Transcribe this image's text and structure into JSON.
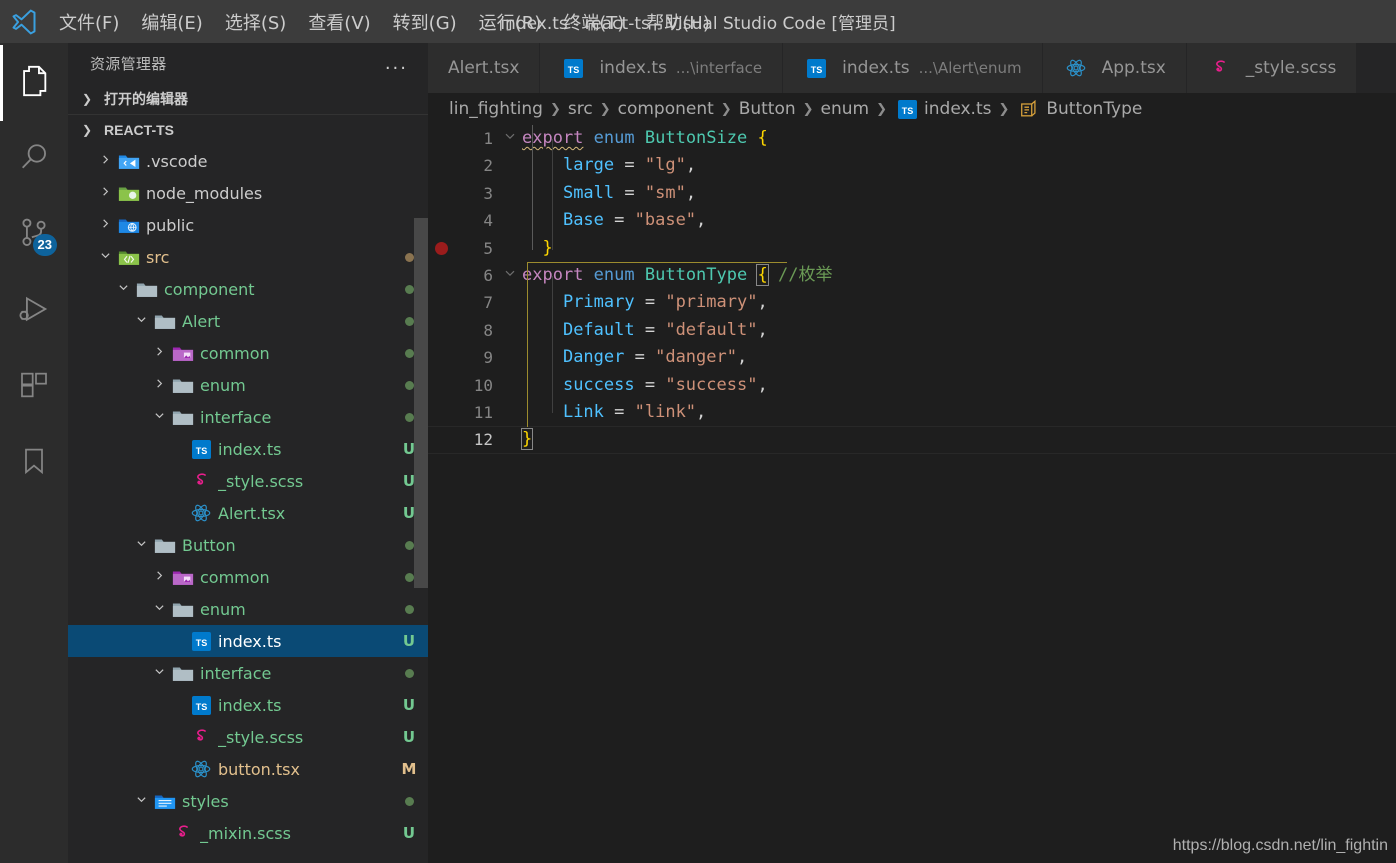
{
  "titlebar": {
    "window_title": "index.ts - react-ts - Visual Studio Code [管理员]",
    "logo_icon": "vscode-logo-icon",
    "menu": [
      {
        "label": "文件(F)"
      },
      {
        "label": "编辑(E)"
      },
      {
        "label": "选择(S)"
      },
      {
        "label": "查看(V)"
      },
      {
        "label": "转到(G)"
      },
      {
        "label": "运行(R)"
      },
      {
        "label": "终端(T)"
      },
      {
        "label": "帮助(H)"
      }
    ]
  },
  "activitybar": {
    "items": [
      {
        "icon": "files-explorer-icon",
        "name": "explorer",
        "active": true,
        "badge": ""
      },
      {
        "icon": "search-icon",
        "name": "search",
        "active": false,
        "badge": ""
      },
      {
        "icon": "source-control-icon",
        "name": "source-control",
        "active": false,
        "badge": "23"
      },
      {
        "icon": "run-debug-icon",
        "name": "run-and-debug",
        "active": false,
        "badge": ""
      },
      {
        "icon": "extensions-icon",
        "name": "extensions",
        "active": false,
        "badge": ""
      },
      {
        "icon": "bookmark-icon",
        "name": "bookmarks",
        "active": false,
        "badge": ""
      }
    ]
  },
  "sidebar": {
    "title": "资源管理器",
    "more_actions": "...",
    "sections": [
      {
        "label": "打开的编辑器",
        "expanded": false
      },
      {
        "label": "REACT-TS",
        "expanded": true
      }
    ],
    "tree": [
      {
        "indent": 1,
        "twisty": "collapsed",
        "icon": "vscode-folder-icon",
        "label": ".vscode",
        "badge": "",
        "color": "plain",
        "selected": false
      },
      {
        "indent": 1,
        "twisty": "collapsed",
        "icon": "node-folder-icon",
        "label": "node_modules",
        "badge": "",
        "color": "plain",
        "selected": false
      },
      {
        "indent": 1,
        "twisty": "collapsed",
        "icon": "public-folder-icon",
        "label": "public",
        "badge": "",
        "color": "plain",
        "selected": false
      },
      {
        "indent": 1,
        "twisty": "expanded",
        "icon": "src-folder-icon",
        "label": "src",
        "badge": "dot",
        "color": "orange",
        "selected": false
      },
      {
        "indent": 2,
        "twisty": "expanded",
        "icon": "folder-icon",
        "label": "component",
        "badge": "dot",
        "color": "green",
        "selected": false
      },
      {
        "indent": 3,
        "twisty": "expanded",
        "icon": "folder-icon",
        "label": "Alert",
        "badge": "dot",
        "color": "green",
        "selected": false
      },
      {
        "indent": 4,
        "twisty": "collapsed",
        "icon": "common-folder-icon",
        "label": "common",
        "badge": "dot",
        "color": "green",
        "selected": false
      },
      {
        "indent": 4,
        "twisty": "collapsed",
        "icon": "folder-icon",
        "label": "enum",
        "badge": "dot",
        "color": "green",
        "selected": false
      },
      {
        "indent": 4,
        "twisty": "expanded",
        "icon": "folder-icon",
        "label": "interface",
        "badge": "dot",
        "color": "green",
        "selected": false
      },
      {
        "indent": 5,
        "twisty": "none",
        "icon": "typescript-icon",
        "label": "index.ts",
        "badge": "U",
        "color": "green",
        "selected": false
      },
      {
        "indent": 5,
        "twisty": "none",
        "icon": "sass-icon",
        "label": "_style.scss",
        "badge": "U",
        "color": "green",
        "selected": false
      },
      {
        "indent": 5,
        "twisty": "none",
        "icon": "react-icon",
        "label": "Alert.tsx",
        "badge": "U",
        "color": "green",
        "selected": false
      },
      {
        "indent": 3,
        "twisty": "expanded",
        "icon": "folder-icon",
        "label": "Button",
        "badge": "dot",
        "color": "green",
        "selected": false
      },
      {
        "indent": 4,
        "twisty": "collapsed",
        "icon": "common-folder-icon",
        "label": "common",
        "badge": "dot",
        "color": "green",
        "selected": false
      },
      {
        "indent": 4,
        "twisty": "expanded",
        "icon": "folder-icon",
        "label": "enum",
        "badge": "dot",
        "color": "green",
        "selected": false
      },
      {
        "indent": 5,
        "twisty": "none",
        "icon": "typescript-icon",
        "label": "index.ts",
        "badge": "U",
        "color": "green",
        "selected": true
      },
      {
        "indent": 4,
        "twisty": "expanded",
        "icon": "folder-icon",
        "label": "interface",
        "badge": "dot",
        "color": "green",
        "selected": false
      },
      {
        "indent": 5,
        "twisty": "none",
        "icon": "typescript-icon",
        "label": "index.ts",
        "badge": "U",
        "color": "green",
        "selected": false
      },
      {
        "indent": 5,
        "twisty": "none",
        "icon": "sass-icon",
        "label": "_style.scss",
        "badge": "U",
        "color": "green",
        "selected": false
      },
      {
        "indent": 5,
        "twisty": "none",
        "icon": "react-icon",
        "label": "button.tsx",
        "badge": "M",
        "color": "orange",
        "selected": false
      },
      {
        "indent": 3,
        "twisty": "expanded",
        "icon": "styles-folder-icon",
        "label": "styles",
        "badge": "dot",
        "color": "green",
        "selected": false
      },
      {
        "indent": 4,
        "twisty": "none",
        "icon": "sass-icon",
        "label": "_mixin.scss",
        "badge": "U",
        "color": "green",
        "selected": false
      }
    ]
  },
  "tabs": [
    {
      "label": "Alert.tsx",
      "desc": "",
      "icon": "none",
      "active": false
    },
    {
      "label": "index.ts",
      "desc": "...\\interface",
      "icon": "typescript-icon",
      "active": false
    },
    {
      "label": "index.ts",
      "desc": "...\\Alert\\enum",
      "icon": "typescript-icon",
      "active": false
    },
    {
      "label": "App.tsx",
      "desc": "",
      "icon": "react-icon",
      "active": false
    },
    {
      "label": "_style.scss",
      "desc": "",
      "icon": "sass-icon",
      "active": false
    }
  ],
  "breadcrumb": [
    {
      "label": "lin_fighting",
      "icon": "none"
    },
    {
      "label": "src",
      "icon": "none"
    },
    {
      "label": "component",
      "icon": "none"
    },
    {
      "label": "Button",
      "icon": "none"
    },
    {
      "label": "enum",
      "icon": "none"
    },
    {
      "label": "index.ts",
      "icon": "typescript-icon"
    },
    {
      "label": "ButtonType",
      "icon": "enum-symbol-icon"
    }
  ],
  "editor": {
    "breakpoint_line": 5,
    "current_line": 12,
    "lines": [
      {
        "n": "1",
        "fold": "expanded",
        "tokens": [
          {
            "t": "export",
            "c": "kw squig"
          },
          {
            "t": " ",
            "c": "op"
          },
          {
            "t": "enum",
            "c": "kw2"
          },
          {
            "t": " ",
            "c": "op"
          },
          {
            "t": "ButtonSize",
            "c": "type"
          },
          {
            "t": " ",
            "c": "op"
          },
          {
            "t": "{",
            "c": "brace"
          }
        ]
      },
      {
        "n": "2",
        "fold": "",
        "tokens": [
          {
            "t": "    ",
            "c": "op"
          },
          {
            "t": "large",
            "c": "prop"
          },
          {
            "t": " = ",
            "c": "op"
          },
          {
            "t": "\"lg\"",
            "c": "str"
          },
          {
            "t": ",",
            "c": "op"
          }
        ]
      },
      {
        "n": "3",
        "fold": "",
        "tokens": [
          {
            "t": "    ",
            "c": "op"
          },
          {
            "t": "Small",
            "c": "prop"
          },
          {
            "t": " = ",
            "c": "op"
          },
          {
            "t": "\"sm\"",
            "c": "str"
          },
          {
            "t": ",",
            "c": "op"
          }
        ]
      },
      {
        "n": "4",
        "fold": "",
        "tokens": [
          {
            "t": "    ",
            "c": "op"
          },
          {
            "t": "Base",
            "c": "prop"
          },
          {
            "t": " = ",
            "c": "op"
          },
          {
            "t": "\"base\"",
            "c": "str"
          },
          {
            "t": ",",
            "c": "op"
          }
        ]
      },
      {
        "n": "5",
        "fold": "",
        "tokens": [
          {
            "t": "  ",
            "c": "op"
          },
          {
            "t": "}",
            "c": "brace"
          }
        ]
      },
      {
        "n": "6",
        "fold": "expanded",
        "tokens": [
          {
            "t": "export",
            "c": "kw"
          },
          {
            "t": " ",
            "c": "op"
          },
          {
            "t": "enum",
            "c": "kw2"
          },
          {
            "t": " ",
            "c": "op"
          },
          {
            "t": "ButtonType",
            "c": "type"
          },
          {
            "t": " ",
            "c": "op"
          },
          {
            "t": "{",
            "c": "brace bmatch"
          },
          {
            "t": " ",
            "c": "op"
          },
          {
            "t": "//枚举",
            "c": "cmt"
          }
        ]
      },
      {
        "n": "7",
        "fold": "",
        "tokens": [
          {
            "t": "    ",
            "c": "op"
          },
          {
            "t": "Primary",
            "c": "prop"
          },
          {
            "t": " = ",
            "c": "op"
          },
          {
            "t": "\"primary\"",
            "c": "str"
          },
          {
            "t": ",",
            "c": "op"
          }
        ]
      },
      {
        "n": "8",
        "fold": "",
        "tokens": [
          {
            "t": "    ",
            "c": "op"
          },
          {
            "t": "Default",
            "c": "prop"
          },
          {
            "t": " = ",
            "c": "op"
          },
          {
            "t": "\"default\"",
            "c": "str"
          },
          {
            "t": ",",
            "c": "op"
          }
        ]
      },
      {
        "n": "9",
        "fold": "",
        "tokens": [
          {
            "t": "    ",
            "c": "op"
          },
          {
            "t": "Danger",
            "c": "prop"
          },
          {
            "t": " = ",
            "c": "op"
          },
          {
            "t": "\"danger\"",
            "c": "str"
          },
          {
            "t": ",",
            "c": "op"
          }
        ]
      },
      {
        "n": "10",
        "fold": "",
        "tokens": [
          {
            "t": "    ",
            "c": "op"
          },
          {
            "t": "success",
            "c": "prop"
          },
          {
            "t": " = ",
            "c": "op"
          },
          {
            "t": "\"success\"",
            "c": "str"
          },
          {
            "t": ",",
            "c": "op"
          }
        ]
      },
      {
        "n": "11",
        "fold": "",
        "tokens": [
          {
            "t": "    ",
            "c": "op"
          },
          {
            "t": "Link",
            "c": "prop"
          },
          {
            "t": " = ",
            "c": "op"
          },
          {
            "t": "\"link\"",
            "c": "str"
          },
          {
            "t": ",",
            "c": "op"
          }
        ]
      },
      {
        "n": "12",
        "fold": "",
        "tokens": [
          {
            "t": "}",
            "c": "brace bmatch"
          }
        ]
      }
    ]
  },
  "watermark": "https://blog.csdn.net/lin_fightin",
  "colors": {
    "accent": "#007acc",
    "selection": "#0a4a75",
    "git_untracked": "#73c991",
    "git_modified": "#e2c08d",
    "editor_bg": "#1e1e1e",
    "sidebar_bg": "#252526",
    "titlebar_bg": "#3c3c3c"
  }
}
